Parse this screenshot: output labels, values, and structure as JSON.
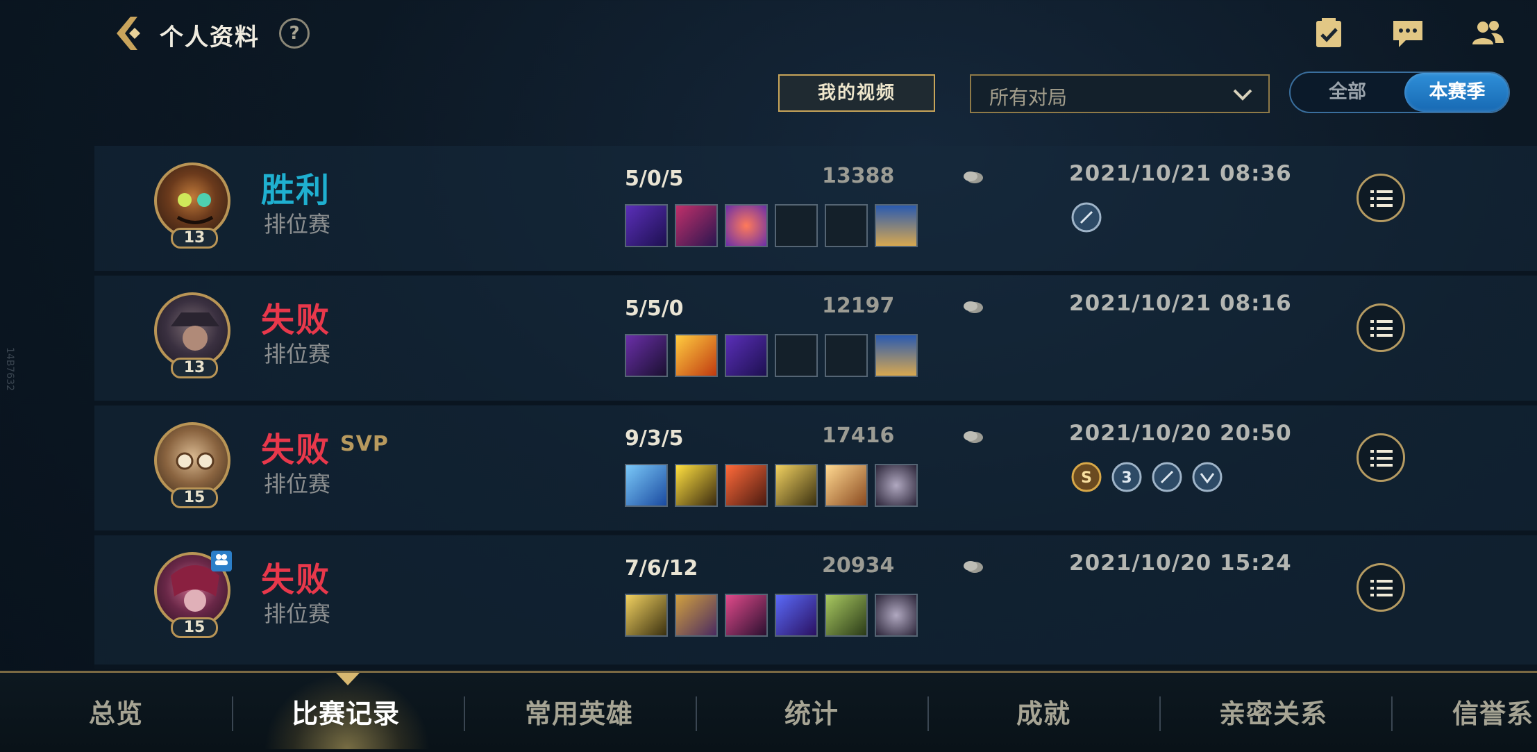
{
  "header": {
    "title": "个人资料",
    "help": "?"
  },
  "controls": {
    "my_videos": "我的视频",
    "filter_value": "所有对局",
    "toggle_all": "全部",
    "toggle_season": "本赛季"
  },
  "side_version": "14B7632",
  "matches": [
    {
      "result": "胜利",
      "mode": "排位赛",
      "level": "13",
      "kda": "5/0/5",
      "gold": "13388",
      "date": "2021/10/21 08:36"
    },
    {
      "result": "失败",
      "mode": "排位赛",
      "level": "13",
      "kda": "5/5/0",
      "gold": "12197",
      "date": "2021/10/21 08:16"
    },
    {
      "result": "失败",
      "svp": "SVP",
      "mode": "排位赛",
      "level": "15",
      "kda": "9/3/5",
      "gold": "17416",
      "date": "2021/10/20 20:50",
      "badge_s": "S",
      "badge_3": "3"
    },
    {
      "result": "失败",
      "mode": "排位赛",
      "level": "15",
      "kda": "7/6/12",
      "gold": "20934",
      "date": "2021/10/20 15:24"
    }
  ],
  "tabs": [
    "总览",
    "比赛记录",
    "常用英雄",
    "统计",
    "成就",
    "亲密关系",
    "信誉系"
  ]
}
